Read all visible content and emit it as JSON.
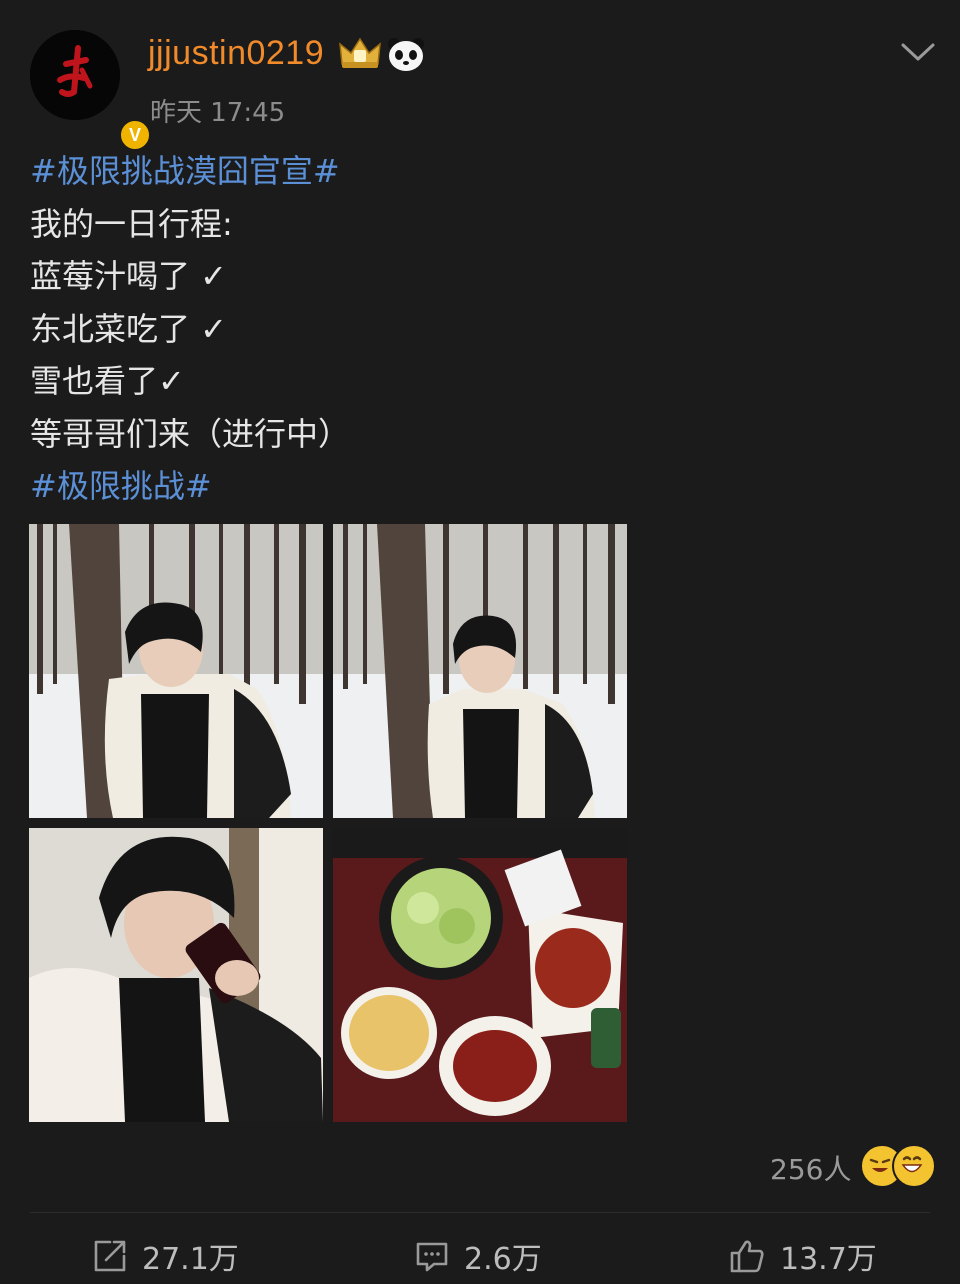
{
  "post": {
    "username": "jjjustin0219",
    "time": "昨天 17:45",
    "lines": [
      {
        "text": "#极限挑战漠囧官宣#",
        "topic": true
      },
      {
        "text": "我的一日行程:",
        "topic": false
      },
      {
        "text": "蓝莓汁喝了 ✓",
        "topic": false
      },
      {
        "text": "东北菜吃了 ✓",
        "topic": false
      },
      {
        "text": "雪也看了✓",
        "topic": false
      },
      {
        "text": "等哥哥们来（进行中）",
        "topic": false
      },
      {
        "text": "#极限挑战#",
        "topic": true
      }
    ],
    "photos": [
      {
        "alt": "snow-forest-portrait-1"
      },
      {
        "alt": "snow-forest-portrait-2"
      },
      {
        "alt": "drinking-juice"
      },
      {
        "alt": "northeast-dishes"
      }
    ],
    "reactions_count": "256人"
  },
  "actions": {
    "repost": "27.1万",
    "comment": "2.6万",
    "like": "13.7万"
  },
  "colors": {
    "background": "#1b1b1b",
    "username": "#f08a2a",
    "topic": "#5b8fd6",
    "verified": "#f0b400"
  },
  "icons": [
    "verified-badge-icon",
    "crown-icon",
    "panda-icon",
    "chevron-down-icon",
    "repost-icon",
    "comment-icon",
    "like-icon"
  ]
}
